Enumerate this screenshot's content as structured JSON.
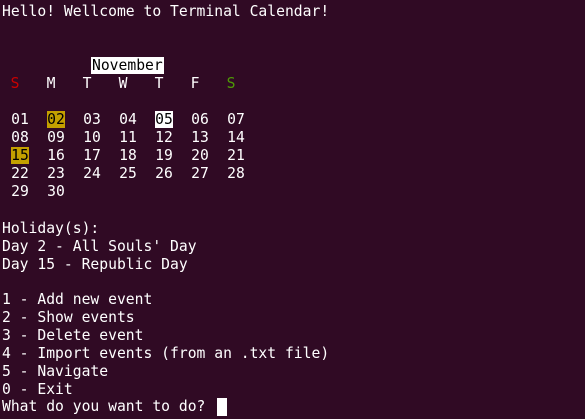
{
  "greeting": "Hello! Wellcome to Terminal Calendar!",
  "calendar": {
    "month": "November",
    "weekdays": [
      "S",
      "M",
      "T",
      "W",
      "T",
      "F",
      "S"
    ],
    "weeks": [
      [
        "01",
        "02",
        "03",
        "04",
        "05",
        "06",
        "07"
      ],
      [
        "08",
        "09",
        "10",
        "11",
        "12",
        "13",
        "14"
      ],
      [
        "15",
        "16",
        "17",
        "18",
        "19",
        "20",
        "21"
      ],
      [
        "22",
        "23",
        "24",
        "25",
        "26",
        "27",
        "28"
      ],
      [
        "29",
        "30"
      ]
    ],
    "holiday_days": [
      "02",
      "15"
    ],
    "today": "05"
  },
  "holidays": {
    "header": "Holiday(s):",
    "items": [
      "Day 2 - All Souls' Day",
      "Day 15 - Republic Day"
    ]
  },
  "menu": {
    "options": [
      "1 - Add new event",
      "2 - Show events",
      "3 - Delete event",
      "4 - Import events (from an .txt file)",
      "5 - Navigate",
      "0 - Exit"
    ]
  },
  "prompt": "What do you want to do? ",
  "colors": {
    "background": "#300a24",
    "holiday_highlight": "#c4a000",
    "today_highlight": "#ffffff",
    "sunday": "#cc0000",
    "saturday": "#4e9a06"
  }
}
